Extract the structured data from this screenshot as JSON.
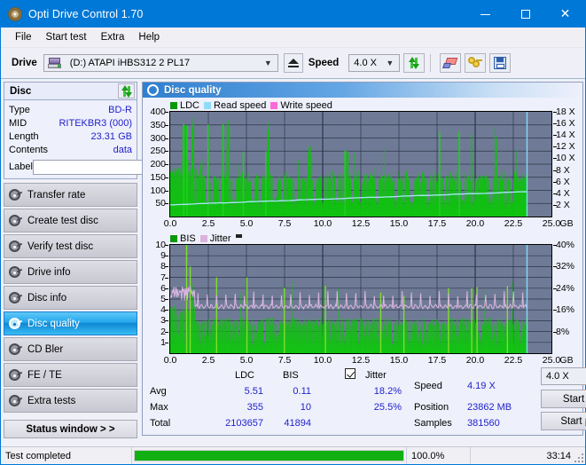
{
  "window": {
    "title": "Opti Drive Control 1.70",
    "icon": "disc-icon",
    "minimize": "minimize",
    "maximize": "maximize",
    "close": "close"
  },
  "menu": {
    "items": [
      "File",
      "Start test",
      "Extra",
      "Help"
    ]
  },
  "toolbar": {
    "drive_label": "Drive",
    "drive_value": "(D:)   ATAPI iHBS312  2 PL17",
    "eject_label": "eject",
    "speed_label": "Speed",
    "speed_value": "4.0 X",
    "refresh_icon": "refresh-icon",
    "erase_icon": "eraser-icon",
    "keys_icon": "keys-icon",
    "save_icon": "floppy-disk-icon"
  },
  "disc": {
    "group_title": "Disc",
    "refresh_icon": "refresh-icon",
    "fields": [
      {
        "key": "Type",
        "value": "BD-R"
      },
      {
        "key": "MID",
        "value": "RITEKBR3 (000)"
      },
      {
        "key": "Length",
        "value": "23.31 GB"
      },
      {
        "key": "Contents",
        "value": "data"
      }
    ],
    "label_key": "Label",
    "label_value": "",
    "label_placeholder": "",
    "cd_icon": "cd-disc-icon"
  },
  "nav": {
    "items": [
      {
        "label": "Transfer rate",
        "active": false
      },
      {
        "label": "Create test disc",
        "active": false
      },
      {
        "label": "Verify test disc",
        "active": false
      },
      {
        "label": "Drive info",
        "active": false
      },
      {
        "label": "Disc info",
        "active": false
      },
      {
        "label": "Disc quality",
        "active": true
      },
      {
        "label": "CD Bler",
        "active": false
      },
      {
        "label": "FE / TE",
        "active": false
      },
      {
        "label": "Extra tests",
        "active": false
      }
    ],
    "status_window": "Status window > >"
  },
  "panel": {
    "title": "Disc quality",
    "icon": "disc-quality-icon"
  },
  "chart_data": [
    {
      "type": "line",
      "id": "ldc-chart",
      "title": "",
      "xlabel": "GB",
      "ylabel": "",
      "legend": [
        {
          "name": "LDC",
          "color": "#089808"
        },
        {
          "name": "Read speed",
          "color": "#8fdcf8"
        },
        {
          "name": "Write speed",
          "color": "#ff6ad5"
        }
      ],
      "legend_position": "top-left",
      "grid": true,
      "x": [
        0.0,
        2.5,
        5.0,
        7.5,
        10.0,
        12.5,
        15.0,
        17.5,
        20.0,
        22.5,
        25.0
      ],
      "xlim": [
        0,
        25.0
      ],
      "ylim": [
        0,
        400
      ],
      "yticks": [
        50,
        100,
        150,
        200,
        250,
        300,
        350,
        400
      ],
      "y2lim": [
        0,
        18
      ],
      "y2ticks": [
        "2 X",
        "4 X",
        "6 X",
        "8 X",
        "10 X",
        "12 X",
        "14 X",
        "16 X",
        "18 X"
      ],
      "series": [
        {
          "name": "LDC",
          "color": "#089808",
          "note": "dense error-count spikes across 0-23.4 GB, baseline ~60-160, large cluster near 0.5-1.5 GB reaching ~355",
          "values": [
            100,
            185,
            200,
            175,
            190,
            345,
            210,
            205,
            348,
            200,
            160,
            205,
            150,
            60,
            140,
            60,
            145,
            150,
            60,
            150,
            160,
            352,
            150,
            60,
            140,
            150,
            160,
            145,
            160,
            150,
            60,
            150,
            155,
            60,
            160,
            150,
            352,
            160,
            60,
            140,
            150,
            60,
            160,
            150,
            155,
            150,
            60,
            160,
            145,
            150,
            160,
            245,
            150,
            60,
            145,
            150,
            60,
            155,
            150,
            160,
            150,
            60,
            145,
            155,
            150,
            250,
            150,
            60,
            150,
            160,
            60,
            145,
            150,
            155,
            160,
            150,
            60,
            150,
            145,
            160,
            150,
            155,
            150,
            60,
            160,
            145,
            150,
            160,
            150,
            60,
            155,
            150,
            145,
            160,
            150,
            60,
            150,
            160,
            145,
            150,
            155,
            60,
            150,
            160,
            150,
            145,
            160,
            150,
            60,
            155,
            150,
            325,
            160,
            150,
            145,
            150,
            160,
            150,
            60,
            150,
            325,
            155,
            150,
            160,
            145,
            150,
            60,
            160,
            150,
            145,
            160,
            150,
            155,
            0,
            0,
            0,
            0,
            0,
            0,
            0,
            0
          ]
        },
        {
          "name": "Read speed",
          "color": "#8fdcf8",
          "note": "CAV-like read speed ramp from ~2.0X to ~4.2X over the scan, vertical jump at end",
          "values": [
            2.0,
            2.1,
            2.15,
            2.2,
            2.3,
            2.4,
            2.5,
            2.6,
            2.7,
            2.8,
            2.9,
            3.0,
            3.05,
            3.1,
            3.2,
            3.3,
            3.4,
            3.45,
            3.5,
            3.6,
            3.7,
            3.8,
            3.9,
            3.95,
            4.0,
            4.05,
            4.1,
            4.15,
            4.2
          ]
        }
      ]
    },
    {
      "type": "line",
      "id": "bis-jitter-chart",
      "title": "",
      "xlabel": "GB",
      "ylabel": "",
      "legend": [
        {
          "name": "BIS",
          "color": "#089808"
        },
        {
          "name": "Jitter",
          "color": "#d9b3dd"
        }
      ],
      "legend_position": "top-left",
      "grid": true,
      "x": [
        0.0,
        2.5,
        5.0,
        7.5,
        10.0,
        12.5,
        15.0,
        17.5,
        20.0,
        22.5,
        25.0
      ],
      "xlim": [
        0,
        25.0
      ],
      "ylim": [
        0,
        10
      ],
      "yticks": [
        1,
        2,
        3,
        4,
        5,
        6,
        7,
        8,
        9,
        10
      ],
      "y2lim": [
        0,
        40
      ],
      "y2ticks": [
        "8%",
        "16%",
        "24%",
        "32%",
        "40%"
      ],
      "series": [
        {
          "name": "BIS",
          "color": "#089808",
          "note": "burst indicator subcode errors, baseline ~3-4 falling to ~1-3 after 2 GB, occasional spikes to 6-10",
          "values": [
            4,
            4.1,
            4,
            3.9,
            4,
            10,
            4.2,
            4,
            8,
            4,
            3.8,
            4,
            3.5,
            1,
            3,
            1,
            3,
            3,
            1,
            3,
            3,
            7,
            3,
            1,
            2.8,
            3,
            3,
            2.8,
            3,
            3,
            1,
            3,
            3,
            1,
            3,
            3,
            7,
            3,
            1,
            2.8,
            3,
            1,
            3,
            3,
            3,
            3,
            1,
            3,
            2.8,
            3,
            3,
            6,
            3,
            1,
            2.8,
            3,
            1,
            3,
            3,
            3,
            3,
            1,
            2.8,
            3,
            3,
            6,
            3,
            1,
            3,
            3,
            1,
            2.8,
            3,
            3,
            3,
            3,
            1,
            3,
            2.8,
            3,
            3,
            3,
            3,
            1,
            3,
            2.8,
            3,
            3,
            3,
            1,
            3,
            3,
            2.8,
            3,
            3,
            1,
            3,
            3,
            2.8,
            3,
            3,
            1,
            3,
            3,
            3,
            2.8,
            3,
            1,
            3,
            3,
            6,
            3,
            3,
            2.8,
            3,
            3,
            3,
            1,
            3,
            6,
            3,
            3,
            3,
            2.8,
            3,
            1,
            3,
            3,
            2.8,
            3,
            3,
            3,
            0,
            0,
            0,
            0,
            0,
            0,
            0,
            0
          ]
        },
        {
          "name": "Jitter",
          "color": "#d9b3dd",
          "note": "jitter trace oscillating around 16-18% with periodic peaks up to 24-26%",
          "values": [
            19,
            22,
            20,
            25,
            21,
            26,
            20,
            24,
            19,
            25,
            20,
            24,
            19,
            22,
            18,
            23,
            18,
            22,
            17.5,
            21,
            17.5,
            22,
            17,
            21,
            17,
            22,
            17,
            21,
            17,
            22,
            17,
            21,
            17,
            22,
            17,
            21,
            17,
            22,
            17,
            21,
            17,
            22,
            17,
            21,
            17,
            22,
            17,
            21,
            17,
            22,
            17,
            21,
            17,
            22,
            17,
            21,
            17,
            22,
            17,
            21,
            17,
            22,
            17,
            21,
            17,
            22,
            17,
            21,
            17,
            22,
            17,
            21,
            17,
            22,
            17,
            21,
            17,
            22,
            17,
            21,
            17,
            22,
            17,
            21,
            17,
            22,
            17,
            21,
            17,
            22,
            17,
            21,
            17,
            22,
            17,
            21,
            17,
            22,
            17,
            21,
            17,
            22,
            17,
            21,
            17,
            22,
            17,
            21,
            17,
            22,
            17,
            24,
            17,
            21,
            17,
            22,
            17,
            21,
            17,
            22,
            17,
            23,
            17,
            21,
            17,
            22,
            17,
            21,
            0,
            0,
            0,
            0
          ]
        }
      ]
    }
  ],
  "stats": {
    "col_headers": [
      "LDC",
      "BIS"
    ],
    "row_headers": [
      "Avg",
      "Max",
      "Total"
    ],
    "ldc": {
      "avg": "5.51",
      "max": "355",
      "total": "2103657"
    },
    "bis": {
      "avg": "0.11",
      "max": "10",
      "total": "41894"
    },
    "jitter": {
      "label": "Jitter",
      "checked": true,
      "avg": "18.2%",
      "max": "25.5%"
    },
    "speed_label": "Speed",
    "speed_value": "4.19 X",
    "position_label": "Position",
    "position_value": "23862 MB",
    "samples_label": "Samples",
    "samples_value": "381560",
    "speed_select": "4.0 X",
    "start_full": "Start full",
    "start_part": "Start part"
  },
  "statusbar": {
    "message": "Test completed",
    "progress_percent": "100.0%",
    "progress_value": 100,
    "elapsed": "33:14"
  },
  "colors": {
    "accent": "#0078d7",
    "plot_bg": "#6f7b96",
    "ldc_green": "#089808",
    "bis_green": "#2fc72f",
    "jitter_pink": "#d9b3dd",
    "read_speed": "#8fdcf8",
    "write_speed": "#ff6ad5",
    "value_blue": "#2222cc",
    "progress_green": "#13b013"
  }
}
